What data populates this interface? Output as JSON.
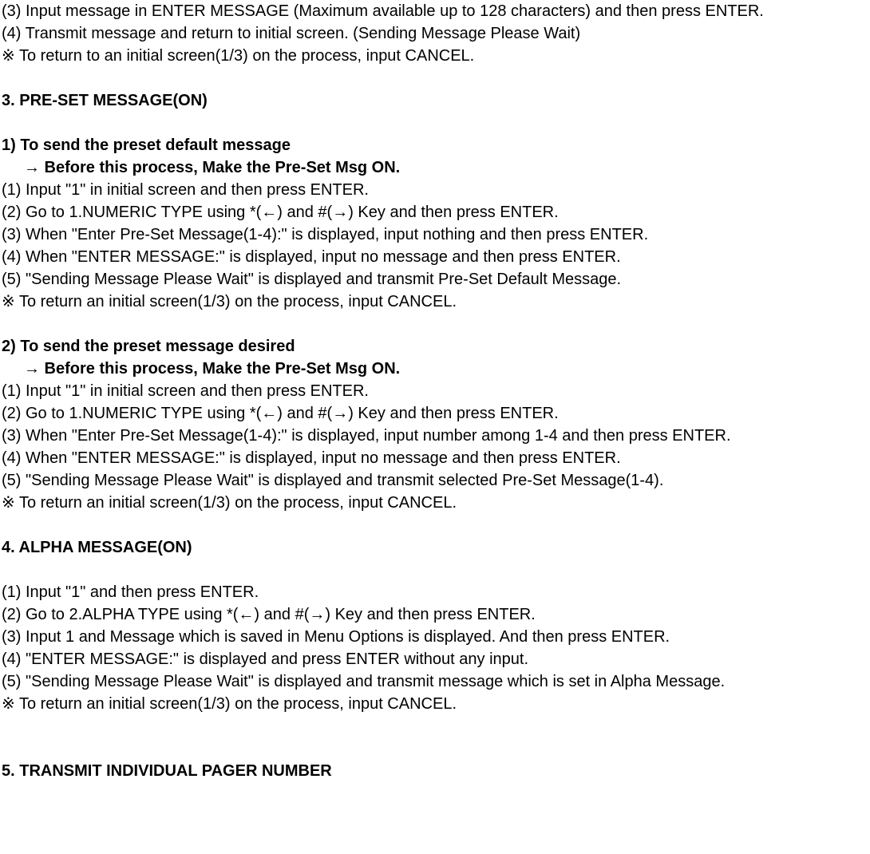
{
  "prelude": {
    "p1": "(3) Input message in ENTER MESSAGE (Maximum available up to 128 characters) and then press ENTER.",
    "p2": "(4) Transmit message and return to initial screen. (Sending Message Please Wait)",
    "p3": "※ To return to an initial screen(1/3) on the process, input CANCEL."
  },
  "section3": {
    "heading": "3. PRE-SET MESSAGE(ON)",
    "sub1": {
      "title": "1) To send the preset default message",
      "note": "→ Before this process, Make the Pre-Set Msg ON.",
      "s1": "(1) Input \"1\" in initial screen and then press ENTER.",
      "s2": "(2) Go to 1.NUMERIC TYPE using *(←) and #(→) Key and then press ENTER.",
      "s3": "(3) When \"Enter Pre-Set Message(1-4):\" is displayed, input nothing and then press ENTER.",
      "s4": "(4) When \"ENTER MESSAGE:\" is displayed, input no message and then press ENTER.",
      "s5": "(5) \"Sending Message Please Wait\" is displayed and transmit Pre-Set Default Message.",
      "s6": "※ To return an initial screen(1/3) on the process, input CANCEL."
    },
    "sub2": {
      "title": "2) To send the preset message desired",
      "note": "→ Before this process, Make the Pre-Set Msg ON.",
      "s1": "(1) Input \"1\" in initial screen and then press ENTER.",
      "s2": "(2) Go to 1.NUMERIC TYPE using *(←) and #(→) Key and then press ENTER.",
      "s3": "(3) When \"Enter Pre-Set Message(1-4):\" is displayed, input number among 1-4 and then press ENTER.",
      "s4": "(4) When \"ENTER MESSAGE:\" is displayed, input no message and then press ENTER.",
      "s5": "(5) \"Sending Message Please Wait\" is displayed and transmit selected Pre-Set Message(1-4).",
      "s6": "※ To return an initial screen(1/3) on the process, input CANCEL."
    }
  },
  "section4": {
    "heading": "4. ALPHA MESSAGE(ON)",
    "s1": "(1) Input \"1\" and then press ENTER.",
    "s2": "(2) Go to 2.ALPHA TYPE using *(←) and #(→) Key and then press ENTER.",
    "s3": "(3) Input 1 and Message which is saved in Menu Options is displayed. And then press ENTER.",
    "s4": "(4) \"ENTER MESSAGE:\" is displayed and press ENTER without any input.",
    "s5": "(5) \"Sending Message Please Wait\" is displayed and transmit message which is set in Alpha Message.",
    "s6": "※ To return an initial screen(1/3) on the process, input CANCEL."
  },
  "section5": {
    "heading": "5. TRANSMIT INDIVIDUAL PAGER NUMBER"
  }
}
